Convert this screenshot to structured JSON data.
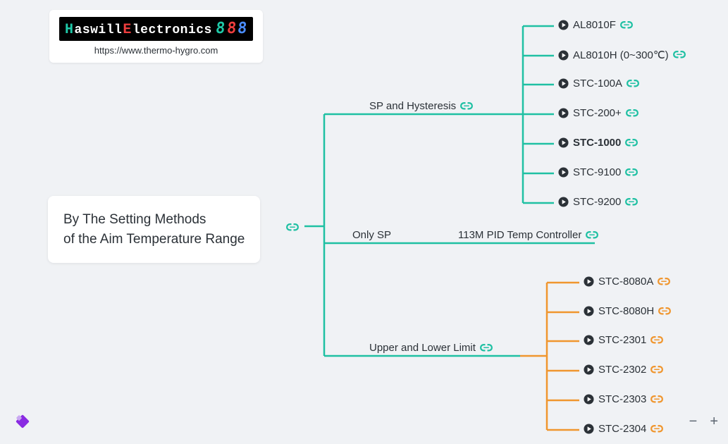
{
  "logo": {
    "brand_part1": "Haswill",
    "brand_part2": "Electronics",
    "url": "https://www.thermo-hygro.com"
  },
  "root": {
    "line1": "By The Setting Methods",
    "line2": "of the Aim Temperature Range"
  },
  "branches": {
    "b1": {
      "label": "SP and Hysteresis"
    },
    "b2": {
      "label": "Only SP",
      "leaf": "113M PID Temp Controller"
    },
    "b3": {
      "label": "Upper and Lower Limit"
    }
  },
  "leaves_sp": [
    "AL8010F",
    "AL8010H (0~300℃)",
    "STC-100A",
    "STC-200+",
    "STC-1000",
    "STC-9100",
    "STC-9200"
  ],
  "leaves_ul": [
    "STC-8080A",
    "STC-8080H",
    "STC-2301",
    "STC-2302",
    "STC-2303",
    "STC-2304"
  ],
  "colors": {
    "teal": "#1fc0a3",
    "orange": "#f0962e",
    "purple": "#8a2be2"
  },
  "zoom": {
    "minus": "−",
    "plus": "+"
  }
}
